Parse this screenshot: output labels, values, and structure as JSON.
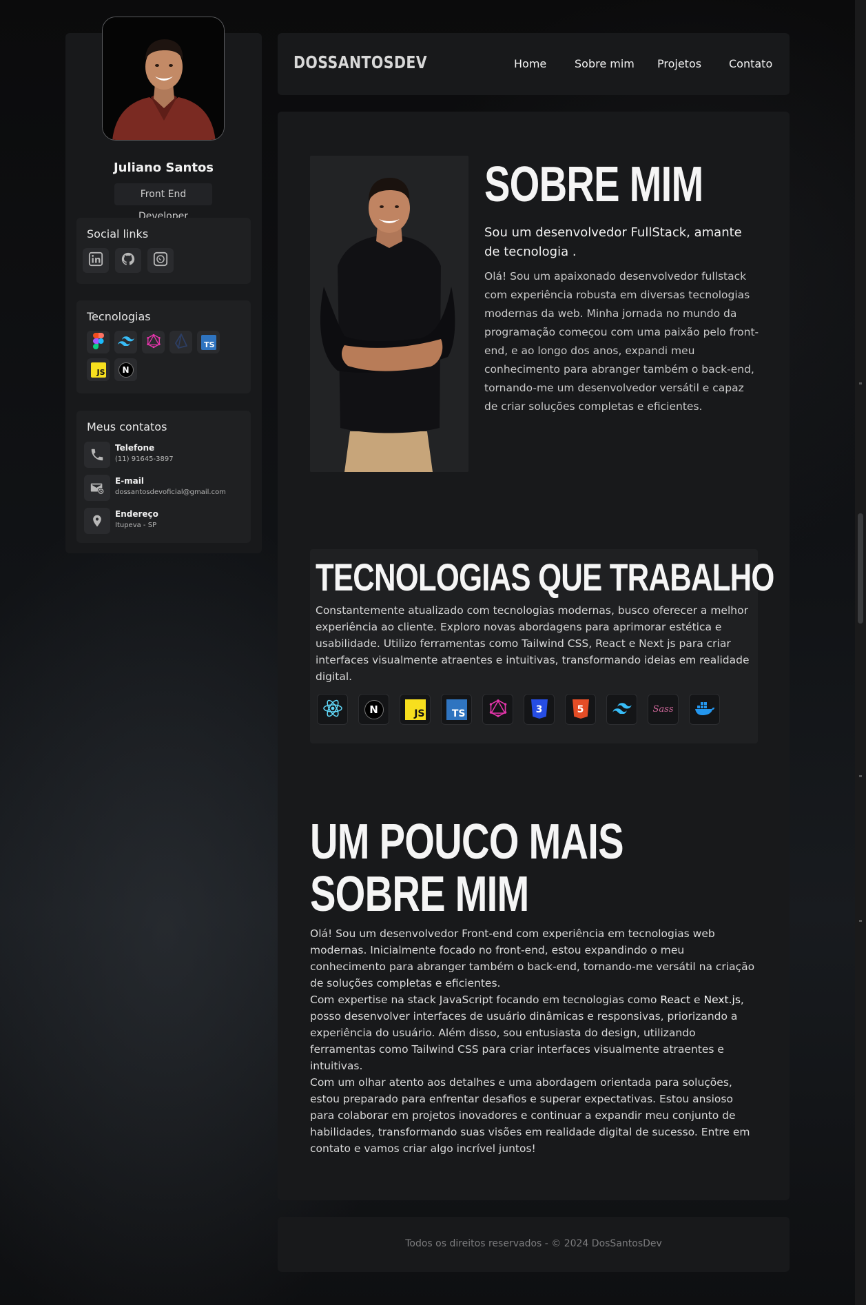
{
  "profile": {
    "name": "Juliano Santos",
    "role": "Front End Developer"
  },
  "social": {
    "title": "Social links",
    "items": [
      {
        "icon": "linkedin-icon"
      },
      {
        "icon": "github-icon"
      },
      {
        "icon": "whatsapp-icon"
      }
    ]
  },
  "sidebar_tech": {
    "title": "Tecnologias",
    "items": [
      {
        "icon": "figma-icon"
      },
      {
        "icon": "tailwind-icon"
      },
      {
        "icon": "graphql-icon"
      },
      {
        "icon": "prisma-icon"
      },
      {
        "icon": "typescript-icon",
        "label": "TS"
      },
      {
        "icon": "javascript-icon",
        "label": "JS"
      },
      {
        "icon": "nextjs-icon",
        "label": "N"
      }
    ]
  },
  "contacts": {
    "title": "Meus contatos",
    "items": [
      {
        "icon": "phone-icon",
        "label": "Telefone",
        "value": "(11) 91645-3897"
      },
      {
        "icon": "mail-icon",
        "label": "E-mail",
        "value": "dossantosdevoficial@gmail.com"
      },
      {
        "icon": "location-pin-icon",
        "label": "Endereço",
        "value": "Itupeva - SP"
      }
    ]
  },
  "header": {
    "brand": "DOSSANTOSDEV",
    "nav": [
      "Home",
      "Sobre mim",
      "Projetos",
      "Contato"
    ]
  },
  "about": {
    "title": "SOBRE MIM",
    "subtitle": "Sou um desenvolvedor FullStack, amante de tecnologia .",
    "text": "Olá! Sou um apaixonado desenvolvedor fullstack com experiência robusta em diversas tecnologias modernas da web. Minha jornada no mundo da programação começou com uma paixão pelo front-end, e ao longo dos anos, expandi meu conhecimento para abranger também o back-end, tornando-me um desenvolvedor versátil e capaz de criar soluções completas e eficientes."
  },
  "technologies": {
    "title": "TECNOLOGIAS QUE TRABALHO",
    "text": "Constantemente atualizado com tecnologias modernas, busco oferecer a melhor experiência ao cliente. Exploro novas abordagens para aprimorar estética e usabilidade. Utilizo ferramentas como Tailwind CSS, React e Next js para criar interfaces visualmente atraentes e intuitivas, transformando ideias em realidade digital.",
    "icons": [
      {
        "icon": "react-icon"
      },
      {
        "icon": "nextjs-icon",
        "label": "N"
      },
      {
        "icon": "javascript-icon",
        "label": "JS"
      },
      {
        "icon": "typescript-icon",
        "label": "TS"
      },
      {
        "icon": "graphql-icon"
      },
      {
        "icon": "css3-icon",
        "label": "3"
      },
      {
        "icon": "html5-icon",
        "label": "5"
      },
      {
        "icon": "tailwind-icon"
      },
      {
        "icon": "sass-icon",
        "label": "Sass"
      },
      {
        "icon": "docker-icon"
      }
    ]
  },
  "more": {
    "title_line1": "UM POUCO MAIS",
    "title_line2": "SOBRE MIM",
    "p1": "Olá! Sou um desenvolvedor Front-end com experiência em tecnologias web modernas. Inicialmente focado no front-end, estou expandindo o meu conhecimento para abranger também o back-end, tornando-me versátil na criação de soluções completas e eficientes.",
    "p2_a": "Com expertise na stack JavaScript focando em tecnologias como ",
    "p2_react": "React",
    "p2_b": " e ",
    "p2_next": "Next.js",
    "p2_c": ", posso desenvolver interfaces de usuário dinâmicas e responsivas, priorizando a experiência do usuário. Além disso, sou entusiasta do design, utilizando ferramentas como Tailwind CSS para criar interfaces visualmente atraentes e intuitivas.",
    "p3": "Com um olhar atento aos detalhes e uma abordagem orientada para soluções, estou preparado para enfrentar desafios e superar expectativas. Estou ansioso para colaborar em projetos inovadores e continuar a expandir meu conjunto de habilidades, transformando suas visões em realidade digital de sucesso. Entre em contato e vamos criar algo incrível juntos!"
  },
  "footer": {
    "text": "Todos os direitos reservados - © 2024 DosSantosDev"
  },
  "colors": {
    "background": "#0c0d0f",
    "panel": "#18191b",
    "card": "#1f2022",
    "text": "#e9e9ea"
  }
}
